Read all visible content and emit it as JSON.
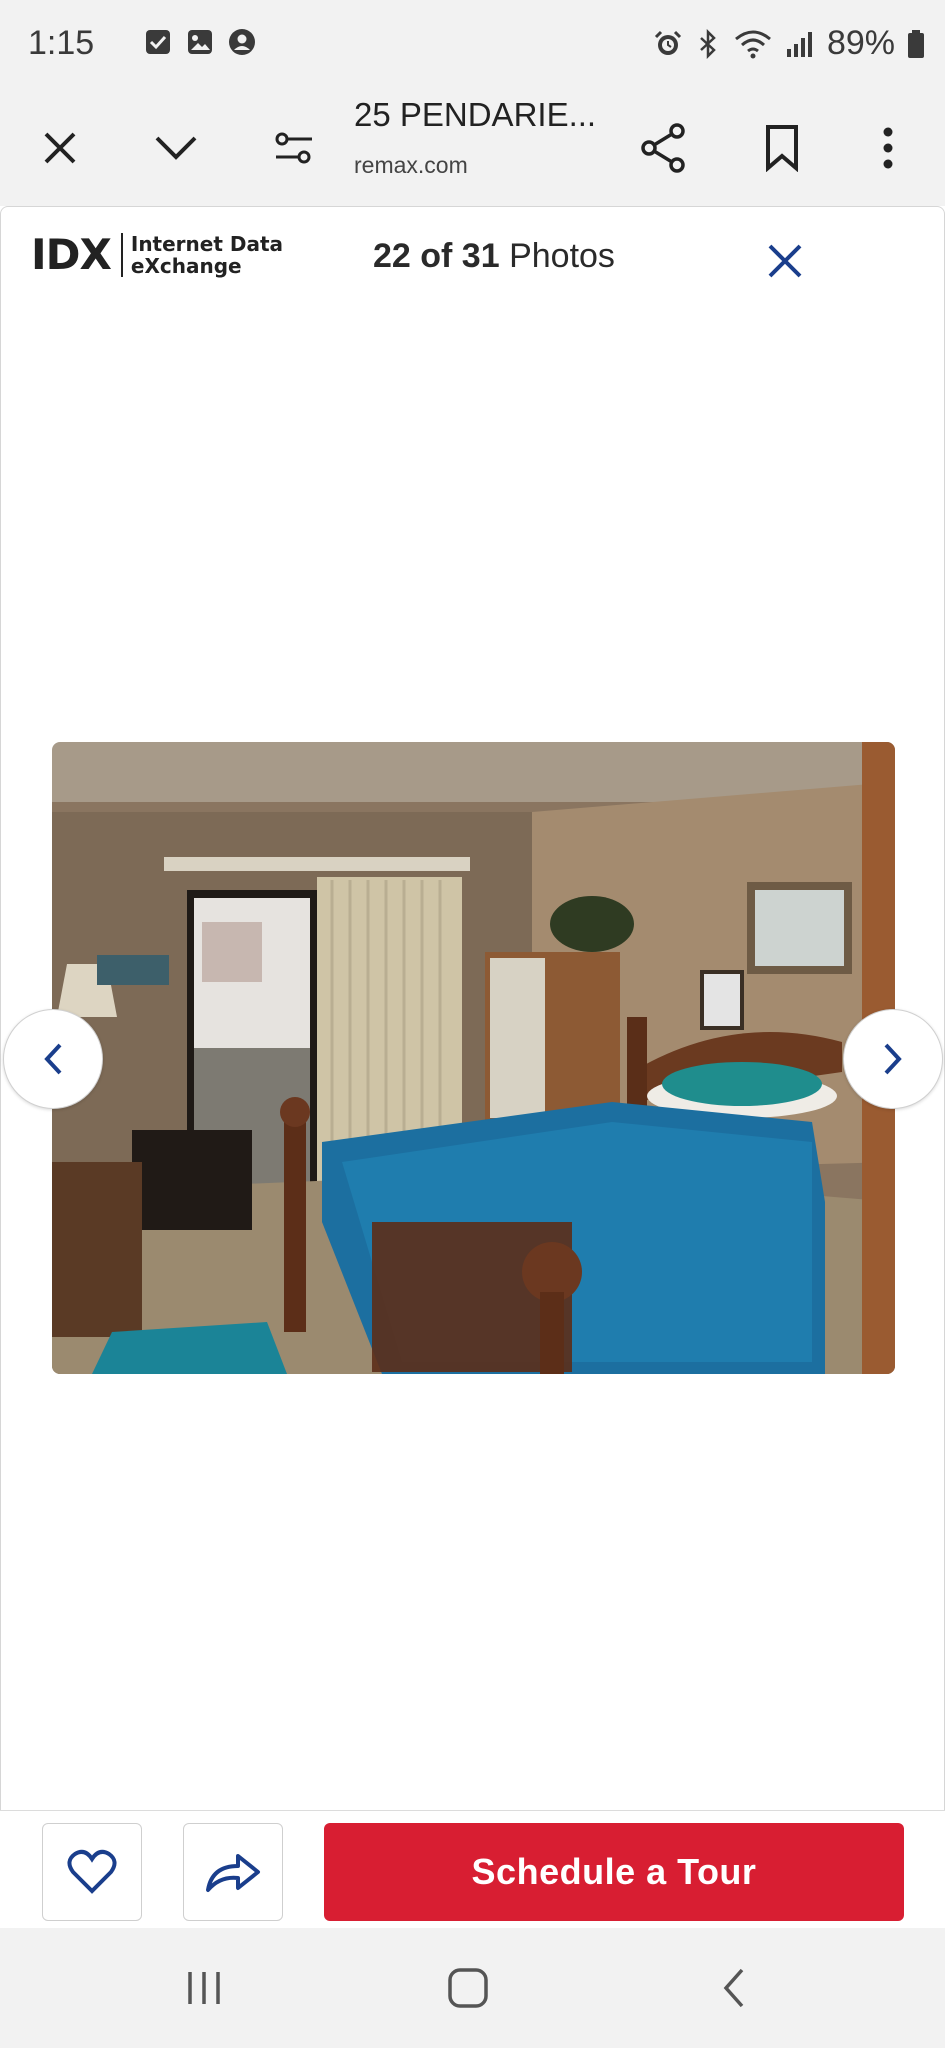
{
  "status_bar": {
    "time": "1:15",
    "battery_percent": "89%",
    "notification_icons": [
      "checkbox-icon",
      "image-icon",
      "account-icon"
    ],
    "system_icons": [
      "alarm-icon",
      "bluetooth-icon",
      "wifi-icon",
      "signal-icon",
      "battery-icon"
    ]
  },
  "browser": {
    "page_title": "25 PENDARIE...",
    "domain": "remax.com"
  },
  "viewer": {
    "logo_text_line1": "Internet Data",
    "logo_text_line2": "eXchange",
    "logo_mark": "IDX",
    "counter": "22 of 31",
    "counter_suffix": "Photos"
  },
  "actions": {
    "schedule_tour_label": "Schedule a Tour"
  },
  "colors": {
    "accent_red": "#d81e32",
    "accent_blue": "#1a3e8c"
  }
}
